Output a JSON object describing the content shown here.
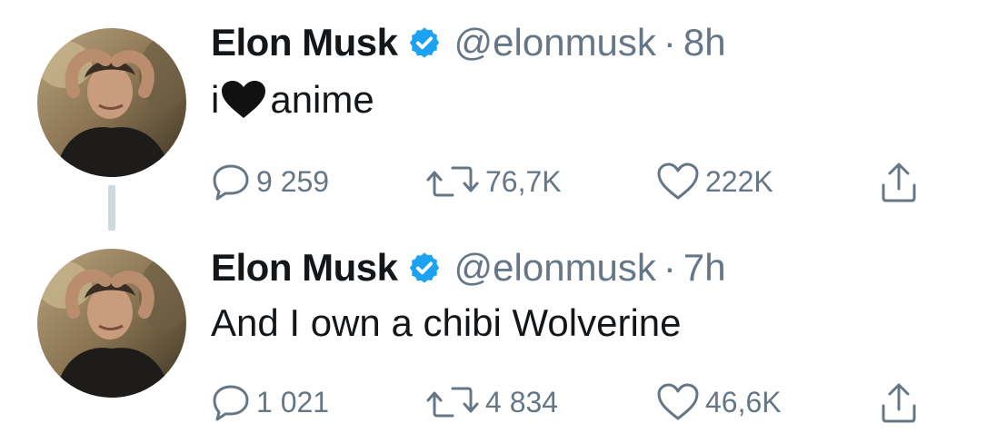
{
  "tweets": [
    {
      "author": {
        "name": "Elon Musk",
        "handle": "@elonmusk",
        "verified": true
      },
      "separator": "·",
      "time": "8h",
      "text_before": "i",
      "emoji": "black-heart",
      "text_after": "anime",
      "replies": "9 259",
      "retweets": "76,7K",
      "likes": "222K"
    },
    {
      "author": {
        "name": "Elon Musk",
        "handle": "@elonmusk",
        "verified": true
      },
      "separator": "·",
      "time": "7h",
      "text": "And I own a chibi Wolverine",
      "replies": "1 021",
      "retweets": "4 834",
      "likes": "46,6K"
    }
  ],
  "colors": {
    "text": "#14171a",
    "secondary": "#657786",
    "verified": "#1da1f2",
    "thread_line": "#cfd9de"
  },
  "icons": [
    "reply-icon",
    "retweet-icon",
    "like-icon",
    "share-icon",
    "verified-badge-icon"
  ]
}
